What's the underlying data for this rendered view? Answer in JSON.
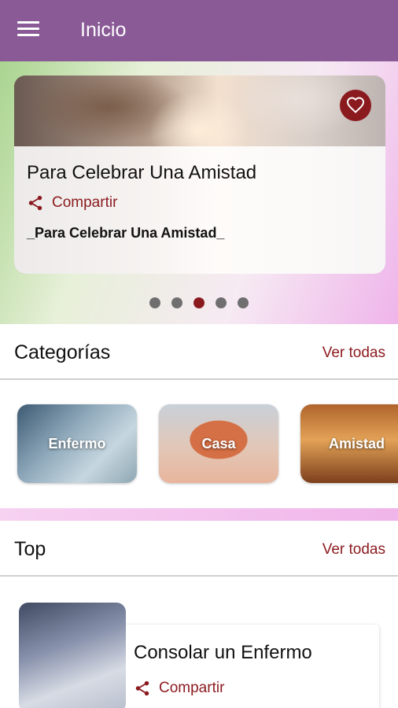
{
  "appbar": {
    "title": "Inicio"
  },
  "hero": {
    "title": "Para Celebrar Una Amistad",
    "share_label": "Compartir",
    "subtitle": "_Para Celebrar Una Amistad_",
    "dots_count": 5,
    "active_dot": 3
  },
  "categories": {
    "title": "Categorías",
    "see_all": "Ver todas",
    "items": [
      {
        "label": "Enfermo"
      },
      {
        "label": "Casa"
      },
      {
        "label": "Amistad"
      }
    ]
  },
  "top": {
    "title": "Top",
    "see_all": "Ver todas",
    "items": [
      {
        "title": "Consolar un Enfermo",
        "share_label": "Compartir"
      }
    ]
  },
  "colors": {
    "appbar": "#8a5a97",
    "accent": "#8b1a1f",
    "dot_inactive": "#6f6f6f"
  },
  "icons": [
    "menu-icon",
    "heart-icon",
    "share-icon"
  ]
}
